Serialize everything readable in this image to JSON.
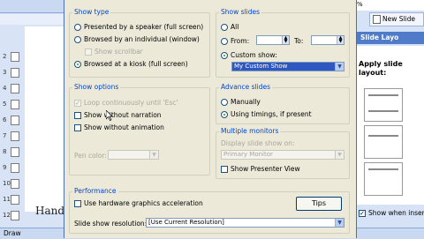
{
  "background_app": {
    "zoom": "%",
    "new_slide": "New Slide",
    "task_pane_title": "Slide Layo",
    "apply_label": "Apply slide layout:",
    "show_when_insert": "Show when inser",
    "handout_text": "Hand",
    "draw_label": "Draw",
    "slide_numbers": [
      "2",
      "3",
      "4",
      "5",
      "6",
      "7",
      "8",
      "9",
      "10",
      "11",
      "12"
    ]
  },
  "dialog": {
    "show_type": {
      "label": "Show type",
      "options": [
        "Presented by a speaker (full screen)",
        "Browsed by an individual (window)",
        "Browsed at a kiosk (full screen)"
      ],
      "selected_index": 2,
      "show_scrollbar": "Show scrollbar"
    },
    "show_slides": {
      "label": "Show slides",
      "all": "All",
      "from": "From:",
      "to": "To:",
      "custom_show": "Custom show:",
      "custom_show_value": "My Custom Show",
      "selected": "custom_show"
    },
    "show_options": {
      "label": "Show options",
      "loop": "Loop continuously until 'Esc'",
      "without_narration": "Show without narration",
      "without_animation": "Show without animation",
      "pen_color": "Pen color:"
    },
    "advance_slides": {
      "label": "Advance slides",
      "manually": "Manually",
      "using_timings": "Using timings, if present",
      "selected": "using_timings"
    },
    "multiple_monitors": {
      "label": "Multiple monitors",
      "display_on": "Display slide show on:",
      "display_value": "Primary Monitor",
      "presenter_view": "Show Presenter View"
    },
    "performance": {
      "label": "Performance",
      "hardware_accel": "Use hardware graphics acceleration",
      "tips": "Tips",
      "resolution_label": "Slide show resolution:",
      "resolution_value": "[Use Current Resolution]"
    }
  }
}
